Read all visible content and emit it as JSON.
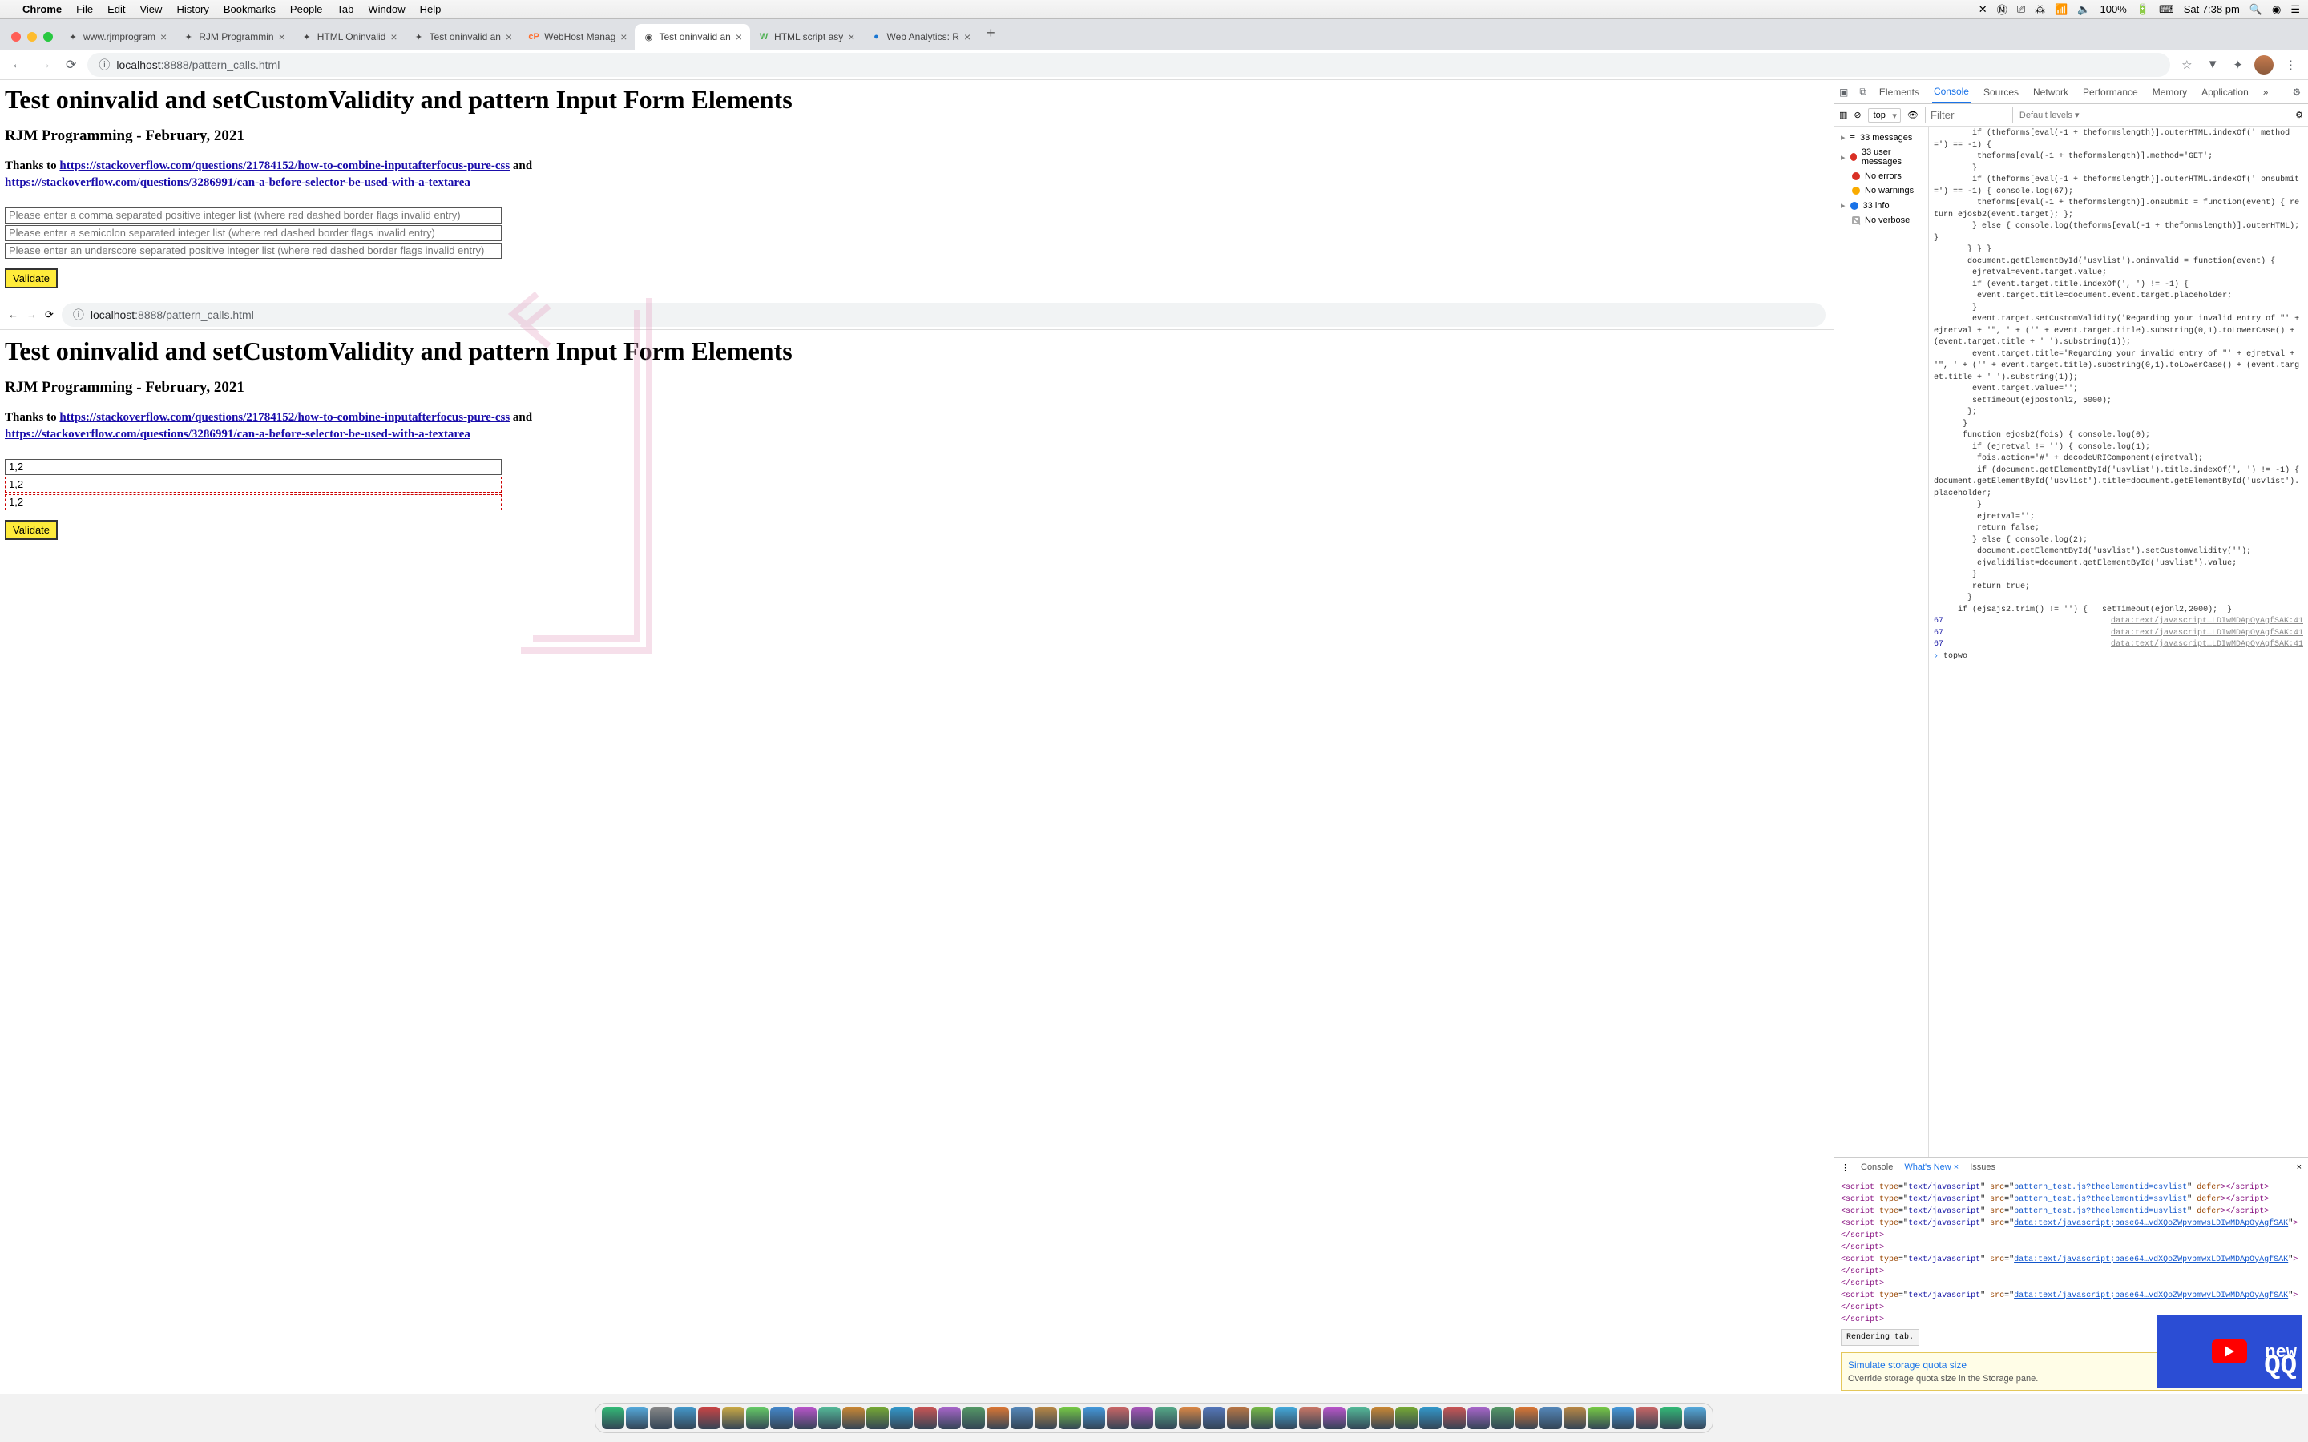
{
  "menubar": {
    "app": "Chrome",
    "items": [
      "File",
      "Edit",
      "View",
      "History",
      "Bookmarks",
      "People",
      "Tab",
      "Window",
      "Help"
    ],
    "battery": "100%",
    "clock": "Sat 7:38 pm"
  },
  "tabs": [
    {
      "title": "www.rjmprogram",
      "fav": "✦"
    },
    {
      "title": "RJM Programmin",
      "fav": "✦"
    },
    {
      "title": "HTML Oninvalid",
      "fav": "✦"
    },
    {
      "title": "Test oninvalid an",
      "fav": "✦"
    },
    {
      "title": "WebHost Manag",
      "fav": "cP"
    },
    {
      "title": "Test oninvalid an",
      "fav": "◉",
      "active": true
    },
    {
      "title": "HTML script asy",
      "fav": "W"
    },
    {
      "title": "Web Analytics: R",
      "fav": "●"
    }
  ],
  "omnibox": {
    "host": "localhost",
    "port": ":8888",
    "path": "/pattern_calls.html"
  },
  "page": {
    "h1": "Test oninvalid and setCustomValidity and pattern Input Form Elements",
    "sub": "RJM Programming - February, 2021",
    "thanks_prefix": "Thanks to ",
    "link1": "https://stackoverflow.com/questions/21784152/how-to-combine-inputafterfocus-pure-css",
    "and": " and",
    "link2": "https://stackoverflow.com/questions/3286991/can-a-before-selector-be-used-with-a-textarea",
    "ph1": "Please enter a comma separated positive integer list (where red dashed border flags invalid entry)",
    "ph2": "Please enter a semicolon separated integer list (where red dashed border flags invalid entry)",
    "ph3": "Please enter an underscore separated positive integer list (where red dashed border flags invalid entry)",
    "validate": "Validate",
    "val12": "1,2"
  },
  "devtools": {
    "tabs": [
      "Elements",
      "Console",
      "Sources",
      "Network",
      "Performance",
      "Memory",
      "Application"
    ],
    "active_tab": "Console",
    "context": "top",
    "filter_ph": "Filter",
    "levels": "Default levels ▾",
    "sidebar": {
      "messages": "33 messages",
      "user": "33 user messages",
      "errors": "No errors",
      "warnings": "No warnings",
      "info": "33 info",
      "verbose": "No verbose"
    },
    "console_lines": [
      "        if (theforms[eval(-1 + theformslength)].outerHTML.indexOf(' method=') == -1) {",
      "         theforms[eval(-1 + theformslength)].method='GET';",
      "        }",
      "        if (theforms[eval(-1 + theformslength)].outerHTML.indexOf(' onsubmit=') == -1) { console.log(67);",
      "         theforms[eval(-1 + theformslength)].onsubmit = function(event) { return ejosb2(event.target); };",
      "        } else { console.log(theforms[eval(-1 + theformslength)].outerHTML);  }",
      "       } } }",
      "",
      "       document.getElementById('usvlist').oninvalid = function(event) {",
      "        ejretval=event.target.value;",
      "        if (event.target.title.indexOf(', ') != -1) {",
      "         event.target.title=document.event.target.placeholder;",
      "        }",
      "        event.target.setCustomValidity('Regarding your invalid entry of \"' + ejretval + '\", ' + ('' + event.target.title).substring(0,1).toLowerCase() + (event.target.title + ' ').substring(1));",
      "        event.target.title='Regarding your invalid entry of \"' + ejretval + '\", ' + ('' + event.target.title).substring(0,1).toLowerCase() + (event.target.title + ' ').substring(1));",
      "        event.target.value='';",
      "        setTimeout(ejpostonl2, 5000);",
      "       };",
      "      }",
      "",
      "      function ejosb2(fois) { console.log(0);",
      "        if (ejretval != '') { console.log(1);",
      "         fois.action='#' + decodeURIComponent(ejretval);",
      "         if (document.getElementById('usvlist').title.indexOf(', ') != -1) {",
      "",
      "document.getElementById('usvlist').title=document.getElementById('usvlist').placeholder;",
      "         }",
      "         ejretval='';",
      "         return false;",
      "        } else { console.log(2);",
      "         document.getElementById('usvlist').setCustomValidity('');",
      "         ejvalidilist=document.getElementById('usvlist').value;",
      "        }",
      "        return true;",
      "       }",
      "",
      "     if (ejsajs2.trim() != '') {   setTimeout(ejonl2,2000);  }"
    ],
    "console_rows": [
      {
        "n": "67",
        "src": "data:text/javascript…LDIwMDApOyAgfSAK:41"
      },
      {
        "n": "67",
        "src": "data:text/javascript…LDIwMDApOyAgfSAK:41"
      },
      {
        "n": "67",
        "src": "data:text/javascript…LDIwMDApOyAgfSAK:41"
      }
    ],
    "prompt": "topwo",
    "drawer_tabs": [
      "Console",
      "What's New",
      "Issues"
    ],
    "scripts": [
      {
        "src": "pattern_test.js?theelementid=csvlist",
        "defer": true
      },
      {
        "src": "pattern_test.js?theelementid=ssvlist",
        "defer": true
      },
      {
        "src": "pattern_test.js?theelementid=usvlist",
        "defer": true
      },
      {
        "src": "data:text/javascript;base64…vdXQoZWpvbmwsLDIwMDApOyAgfSAK",
        "defer": false
      },
      {
        "src": "data:text/javascript;base64…vdXQoZWpvbmwxLDIwMDApOyAgfSAK",
        "defer": false
      },
      {
        "src": "data:text/javascript;base64…vdXQoZWpvbmwyLDIwMDApOyAgfSAK",
        "defer": false
      }
    ],
    "rendering": "Rendering tab.",
    "storage_title": "Simulate storage quota size",
    "storage_sub": "Override storage quota size in the Storage pane.",
    "yt_label": "new"
  }
}
